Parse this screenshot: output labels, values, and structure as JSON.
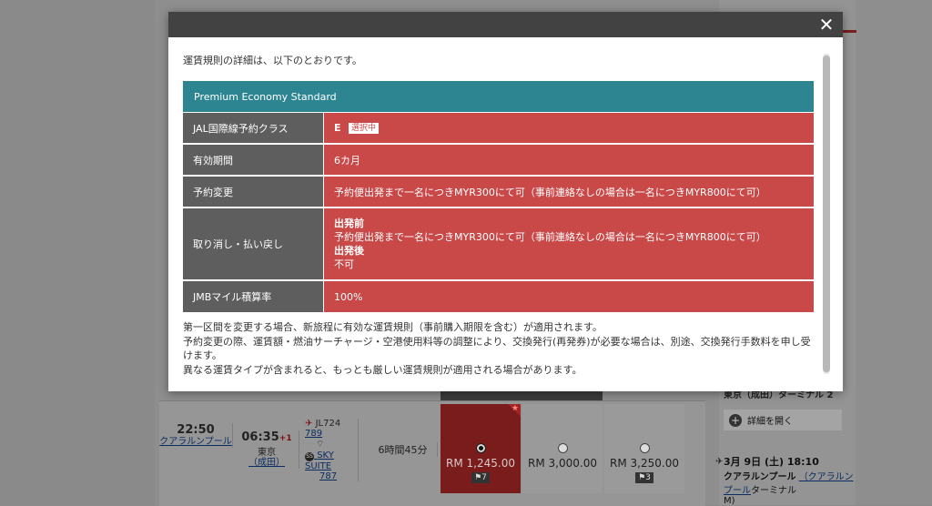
{
  "modal": {
    "close_label": "✕",
    "intro": "運賃規則の詳細は、以下のとおりです。",
    "fare_name": "Premium Economy Standard",
    "rows": [
      {
        "label": "JAL国際線予約クラス",
        "value": "E",
        "badge": "選択中"
      },
      {
        "label": "有効期間",
        "value": "6カ月"
      },
      {
        "label": "予約変更",
        "value": "予約便出発まで一名につきMYR300にて可（事前連絡なしの場合は一名につきMYR800にて可）"
      },
      {
        "label": "取り消し・払い戻し",
        "before_heading": "出発前",
        "before_text": "予約便出発まで一名につきMYR300にて可（事前連絡なしの場合は一名につきMYR800にて可）",
        "after_heading": "出発後",
        "after_text": "不可"
      },
      {
        "label": "JMBマイル積算率",
        "value": "100%"
      }
    ],
    "notes": [
      "第一区間を変更する場合、新旅程に有効な運賃規則（事前購入期限を含む）が適用されます。",
      "予約変更の際、運賃額・燃油サーチャージ・空港使用料等の調整により、交換発行(再発券)が必要な場合は、別途、交換発行手数料を申し受けます。",
      "異なる運賃タイプが含まれると、もっとも厳しい運賃規則が適用される場合があります。"
    ]
  },
  "flight_row": {
    "departure_time": "22:50",
    "departure_place": "クアラルンプール",
    "arrival_time": "06:35",
    "arrival_offset": "+1",
    "arrival_city": "東京",
    "arrival_airport": "（成田）",
    "flight_no": "JL724",
    "aircraft": "789",
    "cabin_product": "SKY SUITE",
    "cabin_aircraft": "787",
    "duration": "6時間45分",
    "fares": [
      {
        "price": "RM 1,245.00",
        "seats": "7",
        "selected": true
      },
      {
        "price": "RM 3,000.00",
        "seats": "",
        "selected": false
      },
      {
        "price": "RM 3,250.00",
        "seats": "3",
        "selected": false
      }
    ]
  },
  "side_panel": {
    "top_text": "東京（成田）ターミナル 2",
    "more_label": "詳細を開く",
    "date_time": "3月 9日 (土) 18:10",
    "airport": "クアラルンプール",
    "airport_link": "（クアラルンプール",
    "terminal": "ターミナル",
    "tail": "M)"
  }
}
